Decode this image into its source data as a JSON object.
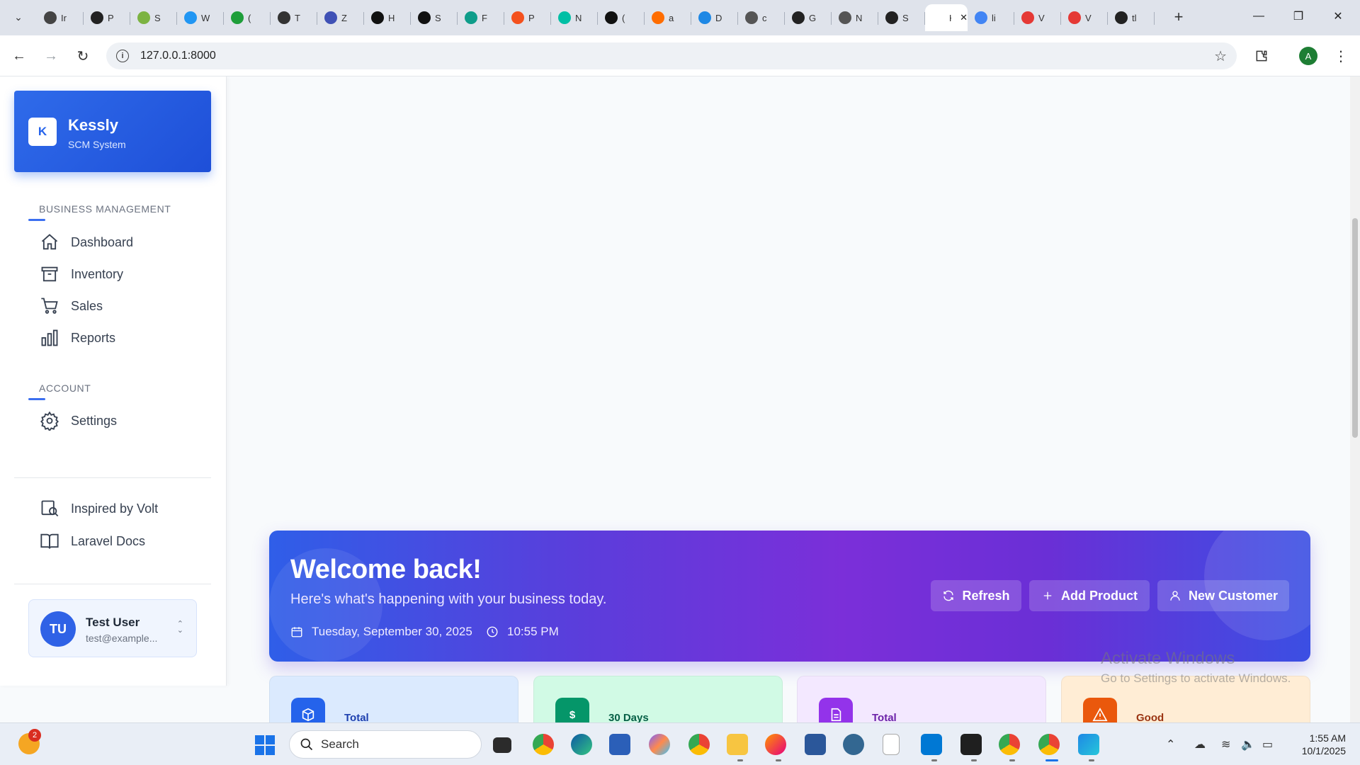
{
  "browser": {
    "tabs": [
      {
        "title": "Ir",
        "color": "#444"
      },
      {
        "title": "P",
        "color": "#222"
      },
      {
        "title": "S",
        "color": "#7cb342"
      },
      {
        "title": "W",
        "color": "#2196f3"
      },
      {
        "title": "(",
        "color": "#1e9e3a"
      },
      {
        "title": "T",
        "color": "#333"
      },
      {
        "title": "Z",
        "color": "#3f51b5"
      },
      {
        "title": "H",
        "color": "#111"
      },
      {
        "title": "S",
        "color": "#111"
      },
      {
        "title": "F",
        "color": "#0f9d8a"
      },
      {
        "title": "P",
        "color": "#f4511e"
      },
      {
        "title": "N",
        "color": "#00bfa5"
      },
      {
        "title": "(",
        "color": "#111"
      },
      {
        "title": "a",
        "color": "#ff6d00"
      },
      {
        "title": "D",
        "color": "#1e88e5"
      },
      {
        "title": "c",
        "color": "#555"
      },
      {
        "title": "G",
        "color": "#222"
      },
      {
        "title": "N",
        "color": "#555"
      },
      {
        "title": "S",
        "color": "#222"
      },
      {
        "title": "K",
        "color": "#ffffff",
        "active": true
      },
      {
        "title": "li",
        "color": "#4285f4"
      },
      {
        "title": "V",
        "color": "#e53935"
      },
      {
        "title": "V",
        "color": "#e53935"
      },
      {
        "title": "tl",
        "color": "#222"
      }
    ],
    "url": "127.0.0.1:8000",
    "profile_initial": "A"
  },
  "sidebar": {
    "brand": {
      "initial": "K",
      "name": "Kessly",
      "subtitle": "SCM System"
    },
    "section_business": "BUSINESS MANAGEMENT",
    "nav_business": [
      {
        "label": "Dashboard",
        "icon": "home-icon"
      },
      {
        "label": "Inventory",
        "icon": "archive-icon"
      },
      {
        "label": "Sales",
        "icon": "cart-icon"
      },
      {
        "label": "Reports",
        "icon": "chart-icon"
      }
    ],
    "section_account": "ACCOUNT",
    "nav_account": [
      {
        "label": "Settings",
        "icon": "gear-icon"
      }
    ],
    "links": [
      {
        "label": "Inspired by Volt",
        "icon": "volt-icon"
      },
      {
        "label": "Laravel Docs",
        "icon": "book-icon"
      }
    ],
    "user": {
      "initials": "TU",
      "name": "Test User",
      "email": "test@example..."
    }
  },
  "hero": {
    "title": "Welcome back!",
    "subtitle": "Here's what's happening with your business today.",
    "date": "Tuesday, September 30, 2025",
    "time": "10:55 PM",
    "buttons": {
      "refresh": "Refresh",
      "add_product": "Add Product",
      "new_customer": "New Customer"
    }
  },
  "stats": [
    {
      "label": "Total",
      "bg": "#dbeafe",
      "icon_bg": "#2563eb",
      "text_color": "#1e40af"
    },
    {
      "label": "30 Days",
      "bg": "#d1fae5",
      "icon_bg": "#059669",
      "text_color": "#065f46",
      "symbol": "$"
    },
    {
      "label": "Total",
      "bg": "#f3e8ff",
      "icon_bg": "#9333ea",
      "text_color": "#6b21a8"
    },
    {
      "label": "Good",
      "bg": "#ffedd5",
      "icon_bg": "#ea580c",
      "text_color": "#9a3412"
    }
  ],
  "watermark": {
    "line1": "Activate Windows",
    "line2": "Go to Settings to activate Windows."
  },
  "taskbar": {
    "search_placeholder": "Search",
    "notification_count": "2",
    "time": "1:55 AM",
    "date": "10/1/2025"
  }
}
